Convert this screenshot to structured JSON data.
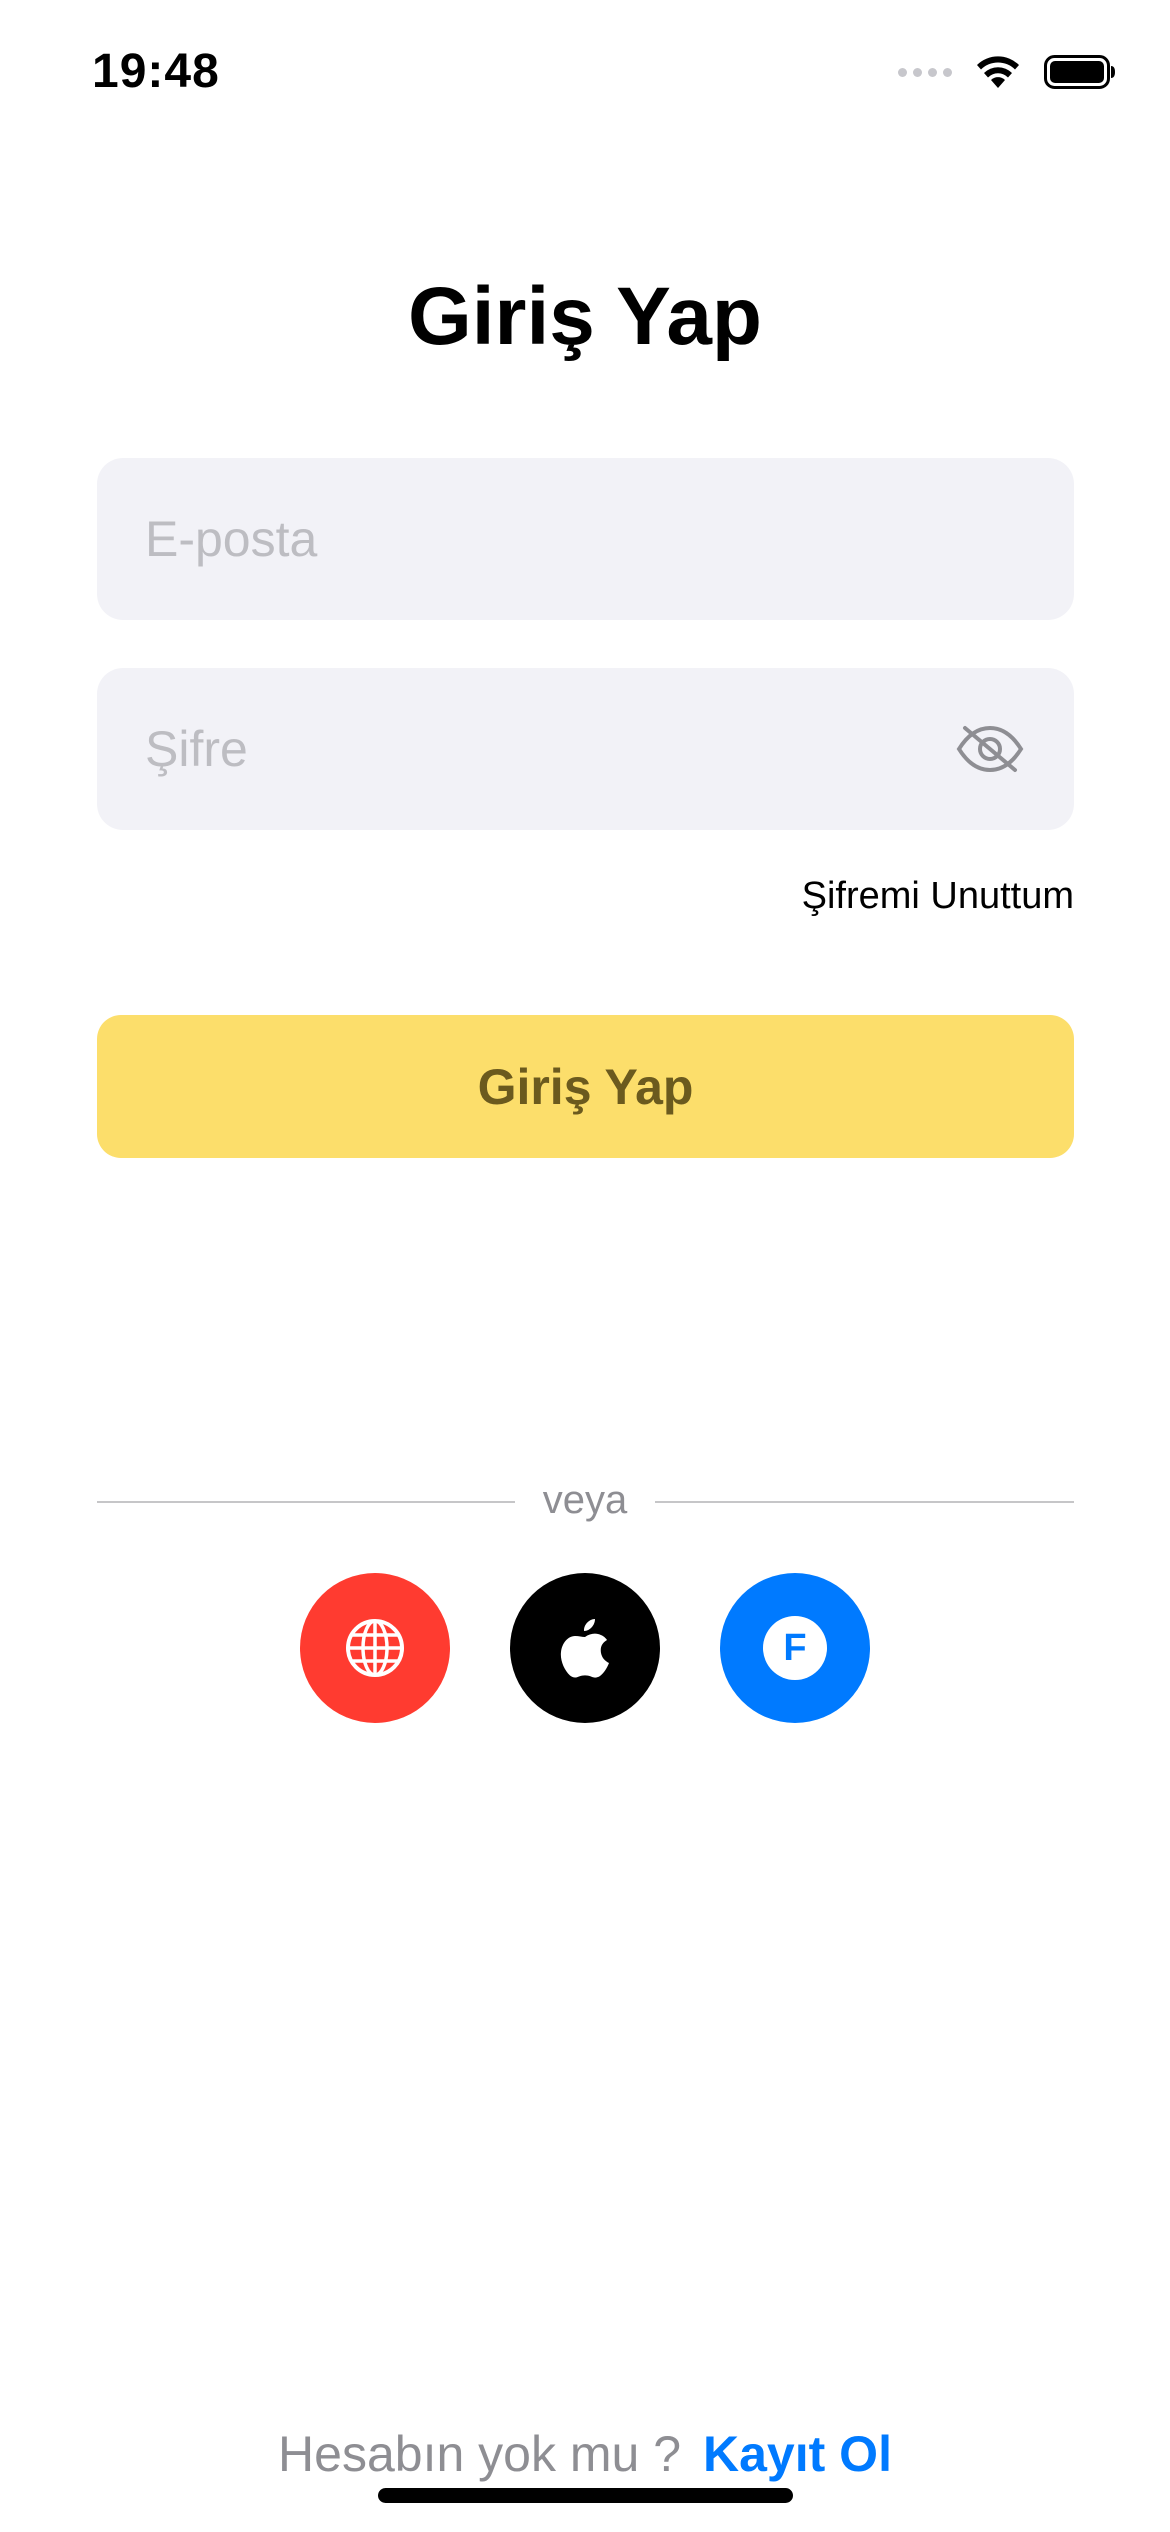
{
  "status_bar": {
    "time": "19:48"
  },
  "header": {
    "title": "Giriş Yap"
  },
  "form": {
    "email": {
      "value": "",
      "placeholder": "E-posta"
    },
    "password": {
      "value": "",
      "placeholder": "Şifre"
    },
    "password_toggle_icon": "eye-slash-icon",
    "forgot_password": "Şifremi Unuttum",
    "login_button": "Giriş Yap"
  },
  "divider": {
    "label": "veya"
  },
  "social": [
    {
      "name": "globe-icon",
      "color": "#ff3b30"
    },
    {
      "name": "apple-icon",
      "color": "#000000"
    },
    {
      "name": "facebook-icon",
      "color": "#007aff",
      "glyph": "F"
    }
  ],
  "footer": {
    "prompt": "Hesabın yok mu ?",
    "signup_link": "Kayıt Ol"
  },
  "colors": {
    "accent": "#fcde6b",
    "link": "#007aff",
    "field_background": "#f2f2f7"
  }
}
